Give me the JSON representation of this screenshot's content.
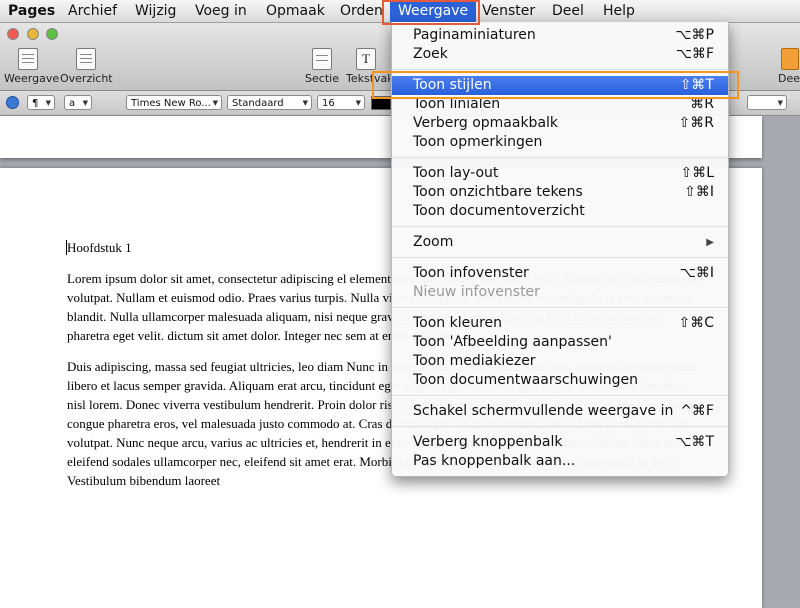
{
  "menubar": {
    "items": [
      "Pages",
      "Archief",
      "Wijzig",
      "Voeg in",
      "Opmaak",
      "Orden",
      "Weergave",
      "Venster",
      "Deel",
      "Help"
    ]
  },
  "toolbar": {
    "weergave_label": "Weergave",
    "overzicht_label": "Overzicht",
    "sectie_label": "Sectie",
    "tekstvak_label": "Tekstvak",
    "deel_label": "Dee"
  },
  "formatbar": {
    "paragraph": "¶",
    "char": "a",
    "font": "Times New Ro...",
    "style": "Standaard",
    "size": "16"
  },
  "document": {
    "heading": "Hoofdstuk 1",
    "paragraph1": "Lorem ipsum dolor sit amet, consectetur adipiscing el elementum enim. Donec nec tortor felis. Nullam ac lo Aliquam erat volutpat. Nullam et euismod odio. Praes varius turpis. Nulla vitae risus purus. Vestibulum erat et ligula et eros accumsan blandit. Nulla ullamcorper malesuada aliquam, nisi neque gravida nisi, nec dapib adipiscing blandit commodo non, pharetra eget velit. dictum sit amet dolor. Integer nec sem at enim aliquam",
    "paragraph2": "Duis adipiscing, massa sed feugiat ultricies, leo diam Nunc in risus at massa malesuada faucibus. Suspendisse malesuada libero et lacus semper gravida. Aliquam erat arcu, tincidunt eget adipiscing vel, varius eget turpis. Vestibulum tincidunt nisl lorem. Donec viverra vestibulum hendrerit. Proin dolor risus, pulvinar non fringilla eget, faucibus sit amet leo. Integer congue pharetra eros, vel malesuada justo commodo at. Cras dictum ligula in justo rutrum cursus. Duis porta commodo volutpat. Nunc neque arcu, varius ac ultricies et, hendrerit in erat. Vivamus volutpat mollis aliquam. Nullam dolor nunc, eleifend sodales ullamcorper nec, eleifend sit amet erat. Morbi felis lacus, ornare ac commodo eu, malesuada ac felis. Vestibulum bibendum laoreet"
  },
  "dropdown": {
    "items": [
      {
        "label": "Paginaminiaturen",
        "shortcut": "⌥⌘P"
      },
      {
        "label": "Zoek",
        "shortcut": "⌥⌘F"
      },
      {
        "label": "Toon stijlen",
        "shortcut": "⇧⌘T"
      },
      {
        "label": "Toon linialen",
        "shortcut": "⌘R"
      },
      {
        "label": "Verberg opmaakbalk",
        "shortcut": "⇧⌘R"
      },
      {
        "label": "Toon opmerkingen",
        "shortcut": ""
      },
      {
        "label": "Toon lay-out",
        "shortcut": "⇧⌘L"
      },
      {
        "label": "Toon onzichtbare tekens",
        "shortcut": "⇧⌘I"
      },
      {
        "label": "Toon documentoverzicht",
        "shortcut": ""
      },
      {
        "label": "Zoom",
        "shortcut": "▶"
      },
      {
        "label": "Toon infovenster",
        "shortcut": "⌥⌘I"
      },
      {
        "label": "Nieuw infovenster",
        "shortcut": ""
      },
      {
        "label": "Toon kleuren",
        "shortcut": "⇧⌘C"
      },
      {
        "label": "Toon 'Afbeelding aanpassen'",
        "shortcut": ""
      },
      {
        "label": "Toon mediakiezer",
        "shortcut": ""
      },
      {
        "label": "Toon documentwaarschuwingen",
        "shortcut": ""
      },
      {
        "label": "Schakel schermvullende weergave in",
        "shortcut": "^⌘F"
      },
      {
        "label": "Verberg knoppenbalk",
        "shortcut": "⌥⌘T"
      },
      {
        "label": "Pas knoppenbalk aan...",
        "shortcut": ""
      }
    ]
  },
  "colors": {
    "menu_selection": "#2b62d8",
    "annotation_menu_box": "#e45a3a",
    "annotation_item_box": "#f5951f"
  }
}
